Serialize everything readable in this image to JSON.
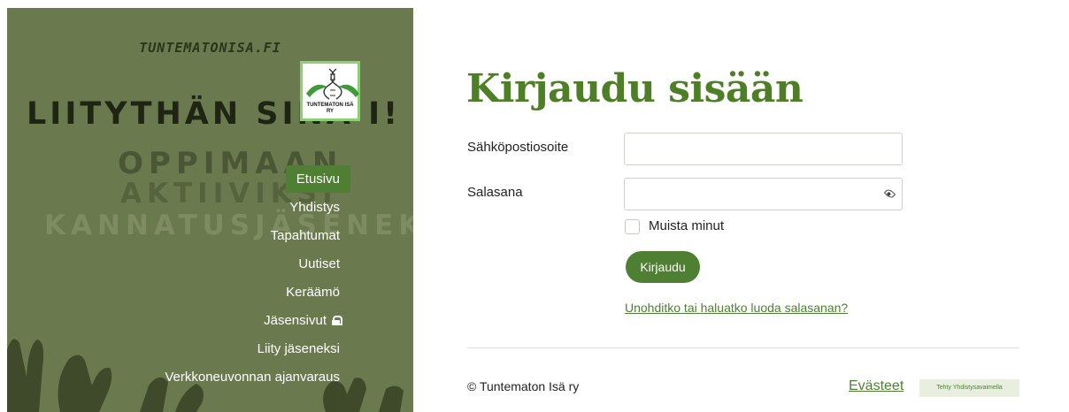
{
  "sidebar": {
    "site_url": "TUNTEMATONISA.FI",
    "slogan": "LIITYTHÄN SINÄ   I!",
    "slogan_bg": [
      "OPPIMAAN",
      "AKTIIVIKSI",
      "KANNATUSJÄSENEKS"
    ],
    "logo_text": "TUNTEMATON ISÄ RY",
    "nav": [
      {
        "label": "Etusivu",
        "active": true
      },
      {
        "label": "Yhdistys"
      },
      {
        "label": "Tapahtumat"
      },
      {
        "label": "Uutiset"
      },
      {
        "label": "Keräämö"
      },
      {
        "label": "Jäsensivut",
        "icon": "lock-icon"
      },
      {
        "label": "Liity jäseneksi"
      },
      {
        "label": "Verkkoneuvonnan ajanvaraus"
      }
    ],
    "colors": {
      "panel": "#6b7a4e",
      "active_item": "#4e7f33"
    }
  },
  "login": {
    "title": "Kirjaudu sisään",
    "email_label": "Sähköpostiosoite",
    "email_value": "",
    "password_label": "Salasana",
    "password_value": "",
    "password_toggle_icon": "eye-icon",
    "remember_label": "Muista minut",
    "remember_checked": false,
    "submit_label": "Kirjaudu",
    "forgot_link": "Unohditko tai haluatko luoda salasanan?"
  },
  "footer": {
    "copyright": "© Tuntematon Isä ry",
    "cookies_link": "Evästeet",
    "made_with": "Tehty Yhdistysavaimella"
  },
  "colors": {
    "accent": "#4e7f33",
    "title": "#4e7f27"
  }
}
